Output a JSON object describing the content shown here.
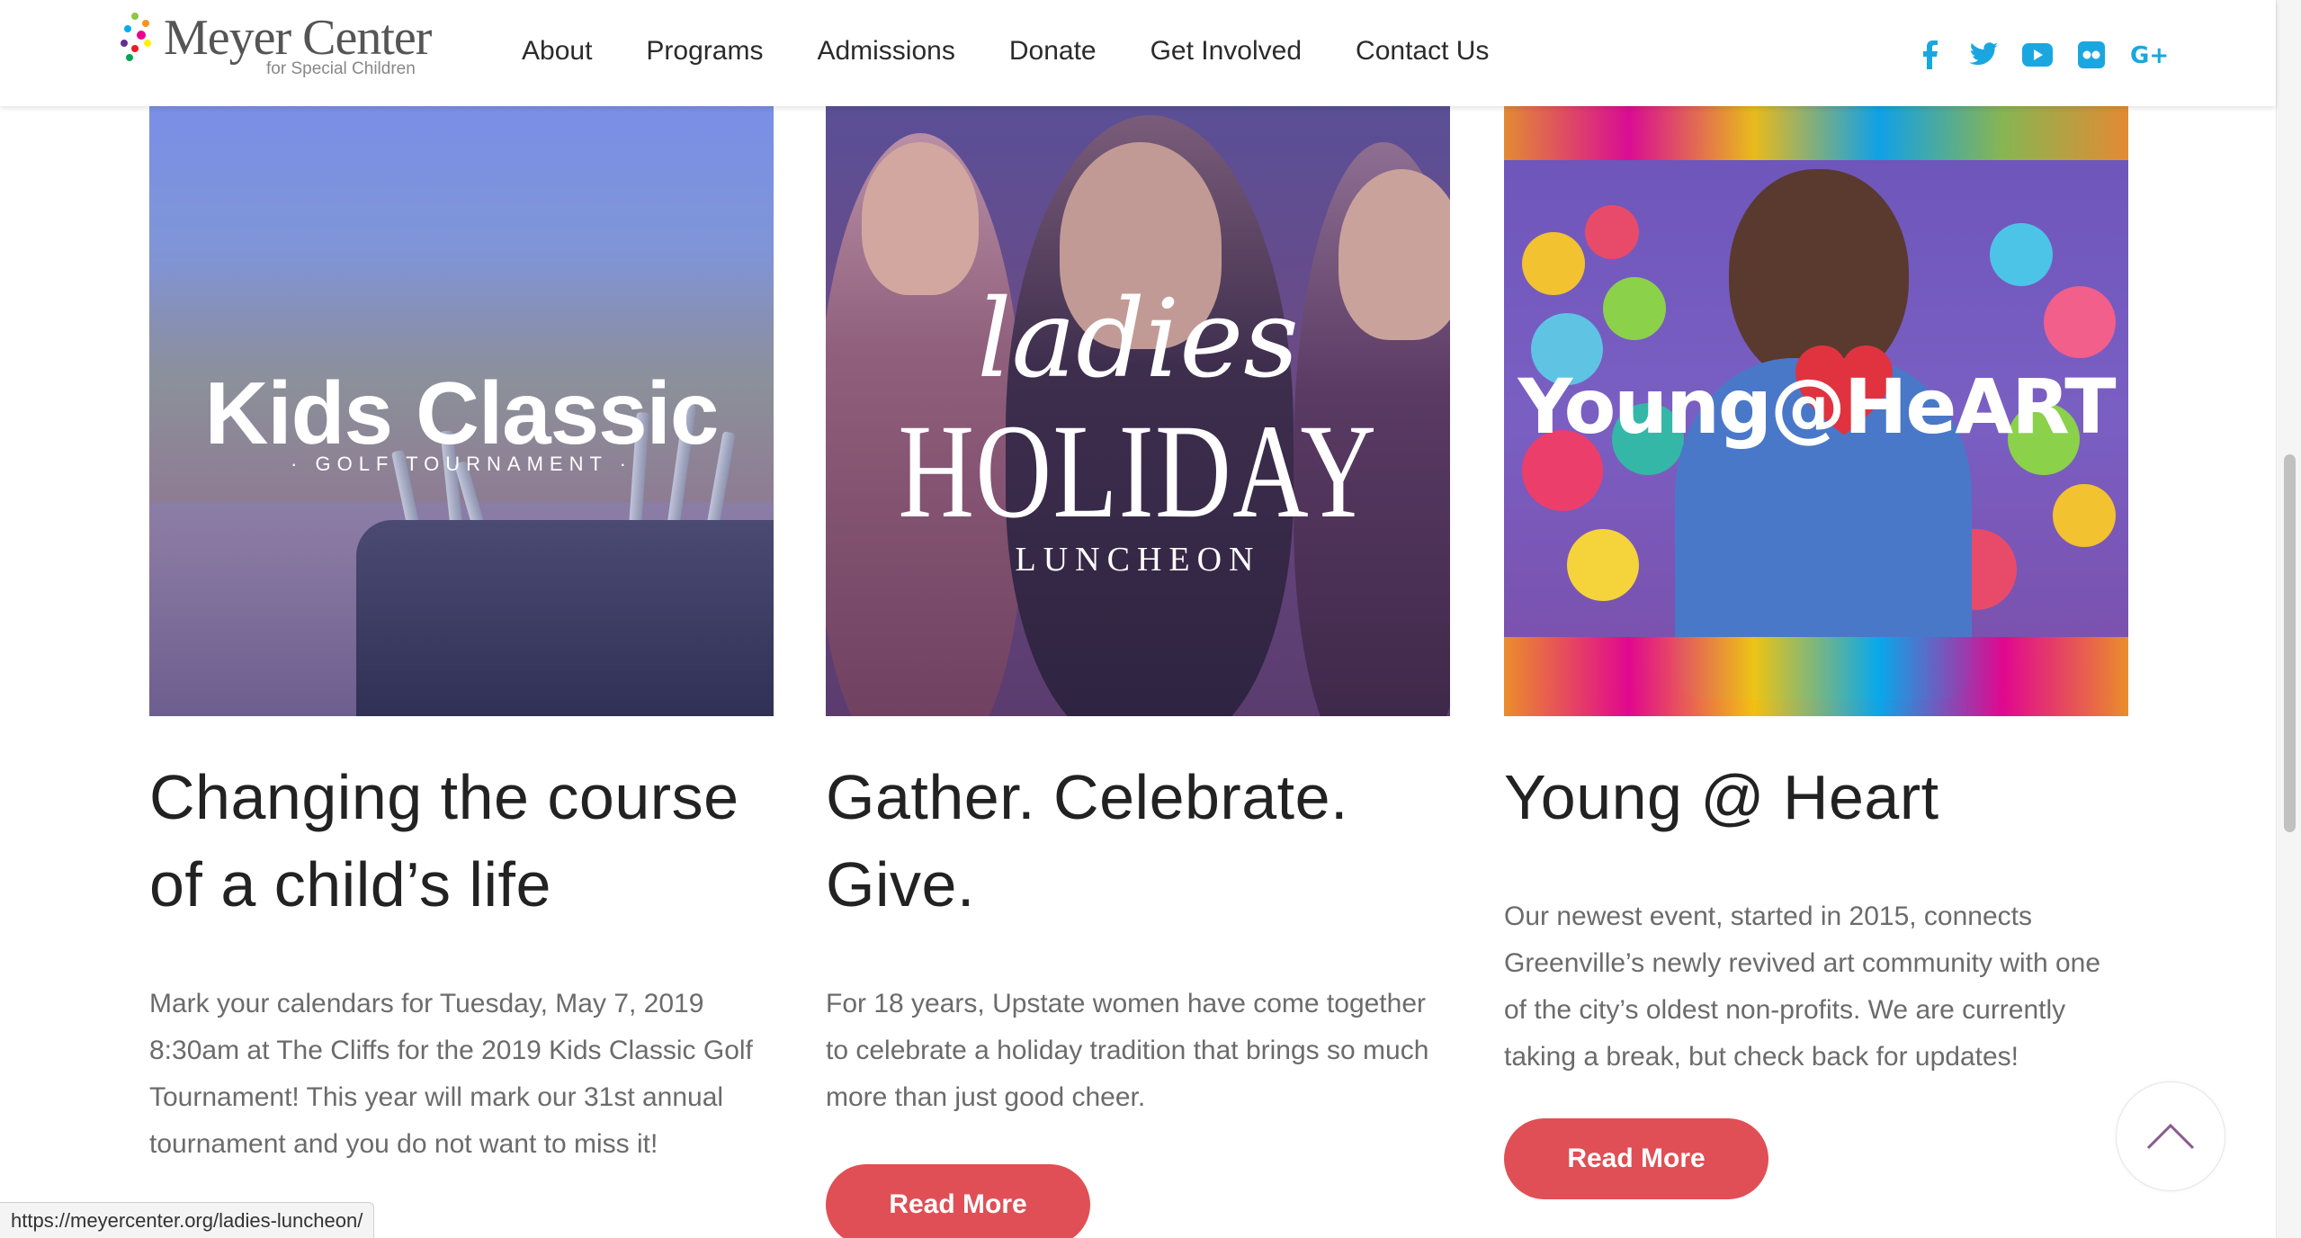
{
  "header": {
    "logo_main": "Meyer Center",
    "logo_sub": "for Special Children",
    "nav": [
      "About",
      "Programs",
      "Admissions",
      "Donate",
      "Get Involved",
      "Contact Us"
    ],
    "social": [
      "facebook-icon",
      "twitter-icon",
      "youtube-icon",
      "flickr-icon",
      "google-plus-icon"
    ],
    "social_color": "#1aa7e0"
  },
  "cards": [
    {
      "image_text": "Kids Classic",
      "image_subtext": "· GOLF TOURNAMENT ·",
      "title": "Changing the course of a child’s life",
      "text": "Mark your calendars for Tuesday, May 7, 2019 8:30am at The Cliffs for the 2019 Kids Classic Golf Tournament!  This year will mark our 31st annual tournament and you do not want to miss it!"
    },
    {
      "image_script": "ladies",
      "image_text": "HOLIDAY",
      "image_subtext": "LUNCHEON",
      "title": "Gather. Celebrate. Give.",
      "text": "For 18 years, Upstate women have come together to celebrate a holiday tradition that brings so much more than just good cheer.",
      "button": "Read More"
    },
    {
      "image_text": "Young@HeART",
      "title": "Young @ Heart",
      "text": "Our newest event, started in 2015, connects Greenville’s newly revived art community with one of the city’s oldest non-profits. We are currently taking a break, but check back for updates!",
      "button": "Read More"
    }
  ],
  "status_url": "https://meyercenter.org/ladies-luncheon/",
  "accent_color": "#e04f55"
}
